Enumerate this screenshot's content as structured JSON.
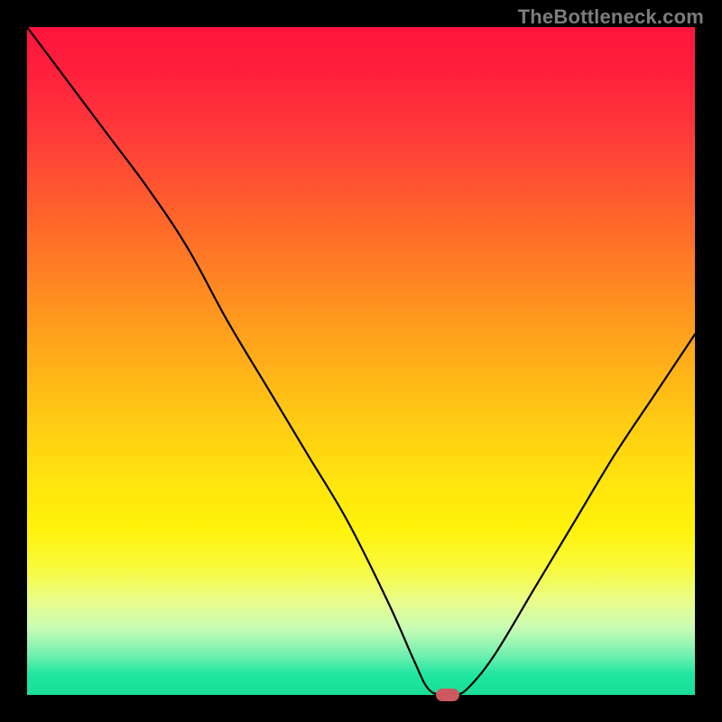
{
  "watermark": {
    "text": "TheBottleneck.com"
  },
  "chart_data": {
    "type": "line",
    "title": "",
    "xlabel": "",
    "ylabel": "",
    "xlim": [
      0,
      100
    ],
    "ylim": [
      0,
      100
    ],
    "background": "heatmap-gradient-green-to-red",
    "series": [
      {
        "name": "bottleneck-curve",
        "x": [
          0,
          6,
          12,
          18,
          24,
          30,
          36,
          42,
          48,
          54,
          58,
          60,
          62,
          64,
          66,
          70,
          76,
          82,
          88,
          94,
          100
        ],
        "values": [
          100,
          92,
          84,
          76,
          67,
          56,
          46,
          36,
          26,
          14,
          5,
          1,
          0,
          0,
          1,
          6,
          16,
          26,
          36,
          45,
          54
        ]
      }
    ],
    "marker": {
      "x": 63,
      "y": 0,
      "shape": "pill",
      "color": "#cc5860"
    },
    "grid": false
  }
}
